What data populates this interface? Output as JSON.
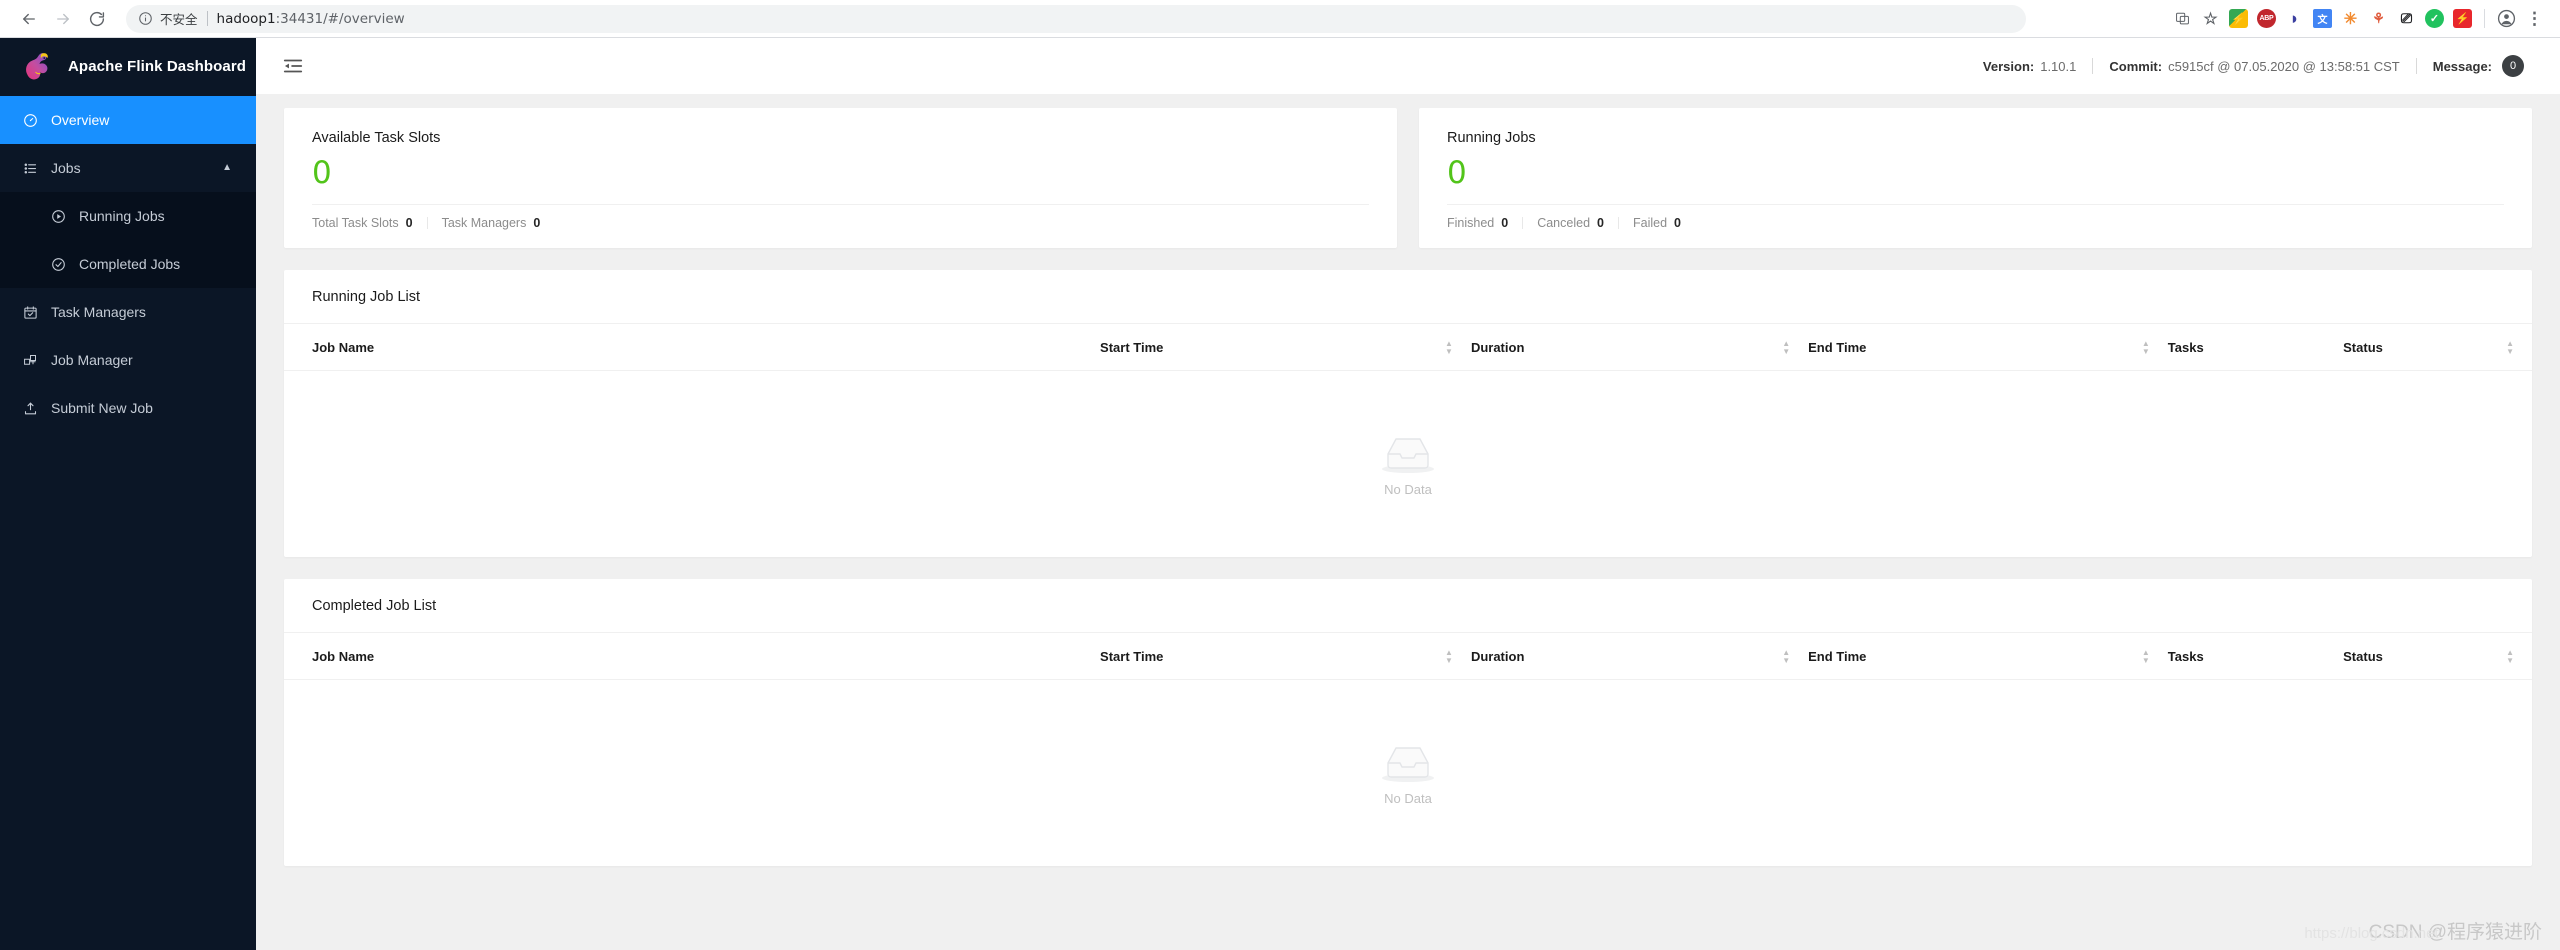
{
  "browser": {
    "back_icon": "back-arrow-icon",
    "forward_icon": "forward-arrow-icon",
    "reload_icon": "reload-icon",
    "security_label": "不安全",
    "url": "hadoop1:34431/#/overview",
    "url_host": "hadoop1",
    "url_rest": ":34431/#/overview",
    "extensions": [
      {
        "name": "translate-icon",
        "glyph": "🗟"
      },
      {
        "name": "bookmark-star-icon",
        "glyph": "☆"
      },
      {
        "name": "lightning-extension-icon",
        "glyph": ""
      },
      {
        "name": "adblock-plus-icon",
        "glyph": "ABP"
      },
      {
        "name": "blue-drop-extension-icon",
        "glyph": "◗"
      },
      {
        "name": "google-translate-icon",
        "glyph": "文"
      },
      {
        "name": "star-colorful-icon",
        "glyph": "✳"
      },
      {
        "name": "tree-diagram-icon",
        "glyph": "⚘"
      },
      {
        "name": "person-box-icon",
        "glyph": "⎚"
      },
      {
        "name": "green-check-icon",
        "glyph": "✓"
      },
      {
        "name": "red-bolt-icon",
        "glyph": "⚡"
      }
    ],
    "profile_icon": "profile-avatar-icon",
    "menu_icon": "chrome-menu-kebab-icon"
  },
  "sidebar": {
    "brand": "Apache Flink Dashboard",
    "items": [
      {
        "label": "Overview",
        "icon": "dashboard-gauge-icon",
        "active": true
      },
      {
        "label": "Jobs",
        "icon": "list-icon",
        "expandable": true,
        "chevron": "▲"
      },
      {
        "label": "Running Jobs",
        "icon": "play-circle-icon",
        "sub": true
      },
      {
        "label": "Completed Jobs",
        "icon": "check-circle-icon",
        "sub": true
      },
      {
        "label": "Task Managers",
        "icon": "calendar-check-icon"
      },
      {
        "label": "Job Manager",
        "icon": "cluster-icon"
      },
      {
        "label": "Submit New Job",
        "icon": "upload-icon"
      }
    ]
  },
  "topbar": {
    "fold_icon": "menu-fold-icon",
    "version_label": "Version:",
    "version_value": "1.10.1",
    "commit_label": "Commit:",
    "commit_value": "c5915cf @ 07.05.2020 @ 13:58:51 CST",
    "message_label": "Message:",
    "message_count": "0"
  },
  "stats": [
    {
      "title": "Available Task Slots",
      "value": "0",
      "footer": [
        {
          "label": "Total Task Slots",
          "value": "0"
        },
        {
          "label": "Task Managers",
          "value": "0"
        }
      ]
    },
    {
      "title": "Running Jobs",
      "value": "0",
      "footer": [
        {
          "label": "Finished",
          "value": "0"
        },
        {
          "label": "Canceled",
          "value": "0"
        },
        {
          "label": "Failed",
          "value": "0"
        }
      ]
    }
  ],
  "running_jobs": {
    "title": "Running Job List",
    "columns": [
      {
        "label": "Job Name",
        "sortable": false
      },
      {
        "label": "Start Time",
        "sortable": true
      },
      {
        "label": "Duration",
        "sortable": true
      },
      {
        "label": "End Time",
        "sortable": true
      },
      {
        "label": "Tasks",
        "sortable": false
      },
      {
        "label": "Status",
        "sortable": true
      }
    ],
    "rows": [],
    "empty_text": "No Data"
  },
  "completed_jobs": {
    "title": "Completed Job List",
    "columns": [
      {
        "label": "Job Name",
        "sortable": false
      },
      {
        "label": "Start Time",
        "sortable": true
      },
      {
        "label": "Duration",
        "sortable": true
      },
      {
        "label": "End Time",
        "sortable": true
      },
      {
        "label": "Tasks",
        "sortable": false
      },
      {
        "label": "Status",
        "sortable": true
      }
    ],
    "rows": [],
    "empty_text": "No Data"
  },
  "watermark": {
    "url": "https://blog.csdn.net",
    "text": "CSDN @程序猿进阶"
  },
  "colors": {
    "accent": "#1890ff",
    "sidebar": "#0b1626",
    "submenu": "#060f1c",
    "value_green": "#52c41a",
    "page_bg": "#f0f0f0"
  }
}
